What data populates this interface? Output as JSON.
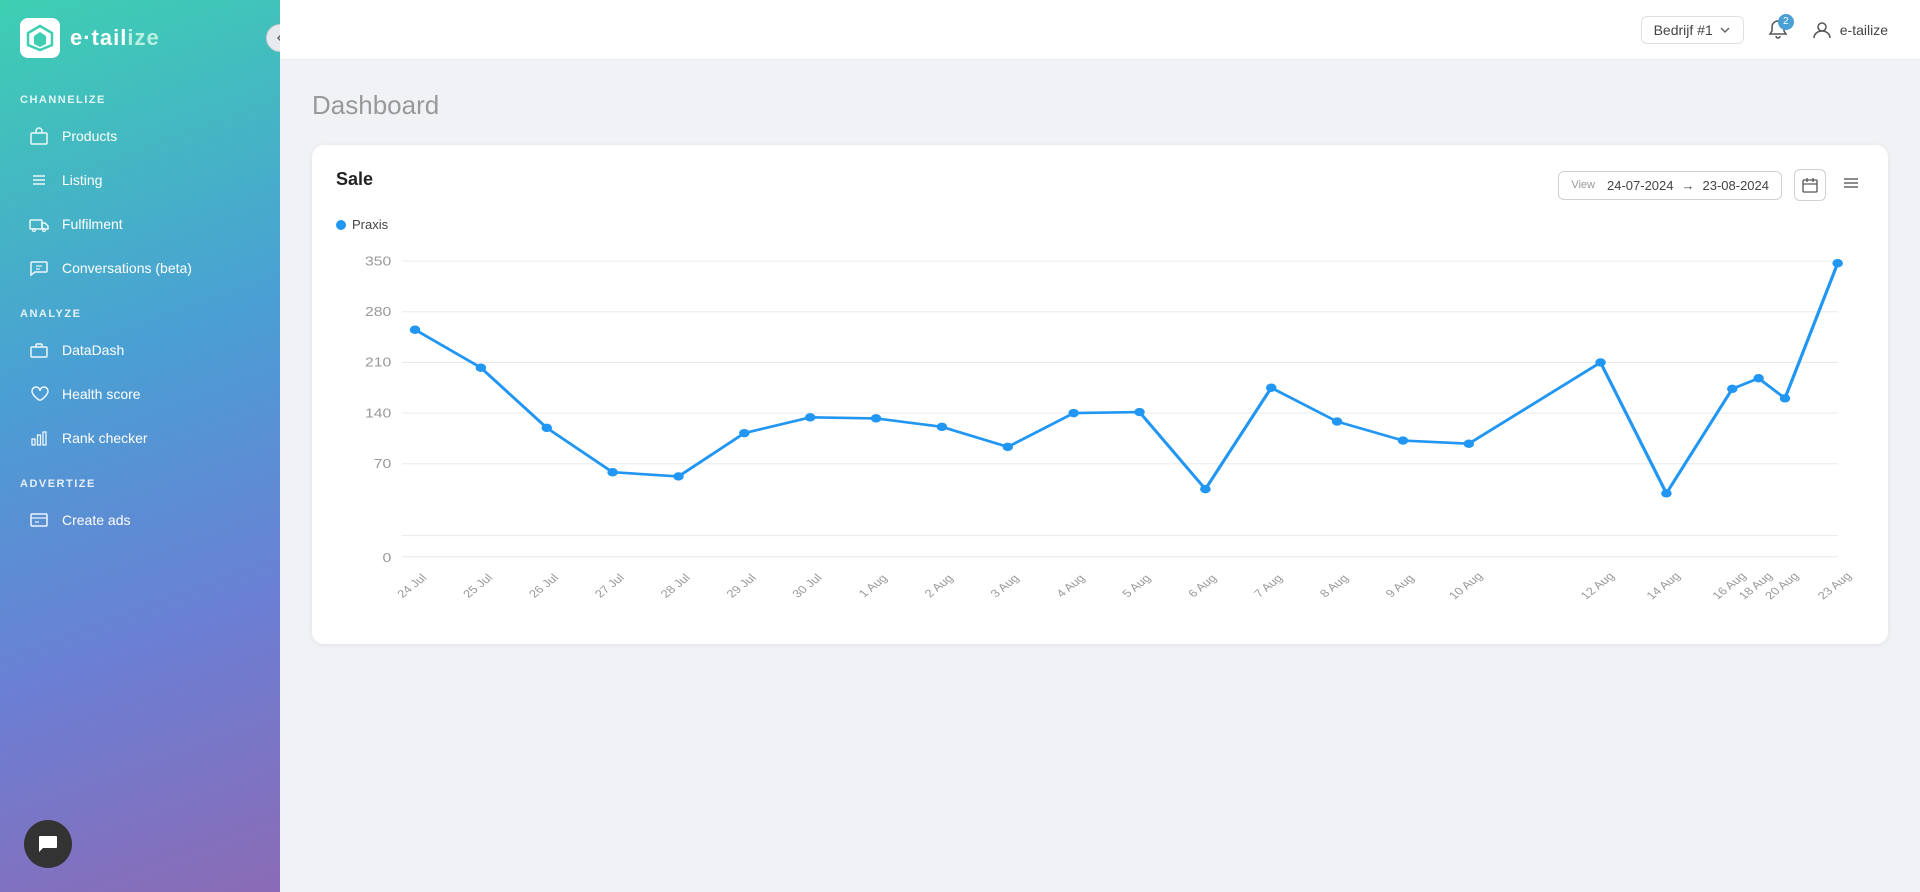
{
  "app": {
    "logo_text_1": "e·tail",
    "logo_text_2": "ize"
  },
  "topbar": {
    "company": "Bedrijf #1",
    "notification_count": "2",
    "user_label": "e-tailize"
  },
  "sidebar": {
    "sections": [
      {
        "label": "CHANNELIZE",
        "items": [
          {
            "id": "products",
            "label": "Products",
            "icon": "box"
          },
          {
            "id": "listing",
            "label": "Listing",
            "icon": "list"
          },
          {
            "id": "fulfilment",
            "label": "Fulfilment",
            "icon": "truck"
          },
          {
            "id": "conversations",
            "label": "Conversations (beta)",
            "icon": "chat"
          }
        ]
      },
      {
        "label": "ANALYZE",
        "items": [
          {
            "id": "datadash",
            "label": "DataDash",
            "icon": "briefcase"
          },
          {
            "id": "healthscore",
            "label": "Health score",
            "icon": "heart"
          },
          {
            "id": "rankchecker",
            "label": "Rank checker",
            "icon": "bar-chart"
          }
        ]
      },
      {
        "label": "ADVERTIZE",
        "items": [
          {
            "id": "createads",
            "label": "Create ads",
            "icon": "ads"
          }
        ]
      }
    ]
  },
  "page": {
    "title": "Dashboard"
  },
  "chart": {
    "title": "Sale",
    "legend_label": "Praxis",
    "view_label": "View",
    "date_from": "24-07-2024",
    "arrow": "→",
    "date_to": "23-08-2024",
    "y_labels": [
      "350",
      "280",
      "210",
      "140",
      "70",
      "0"
    ],
    "x_labels": [
      "24 Jul",
      "25 Jul",
      "26 Jul",
      "27 Jul",
      "28 Jul",
      "29 Jul",
      "30 Jul",
      "1 Aug",
      "2 Aug",
      "3 Aug",
      "4 Aug",
      "5 Aug",
      "6 Aug",
      "7 Aug",
      "8 Aug",
      "9 Aug",
      "10 Aug",
      "12 Aug",
      "14 Aug",
      "16 Aug",
      "18 Aug",
      "20 Aug",
      "23 Aug"
    ]
  },
  "chat_button": {
    "label": "💬"
  }
}
